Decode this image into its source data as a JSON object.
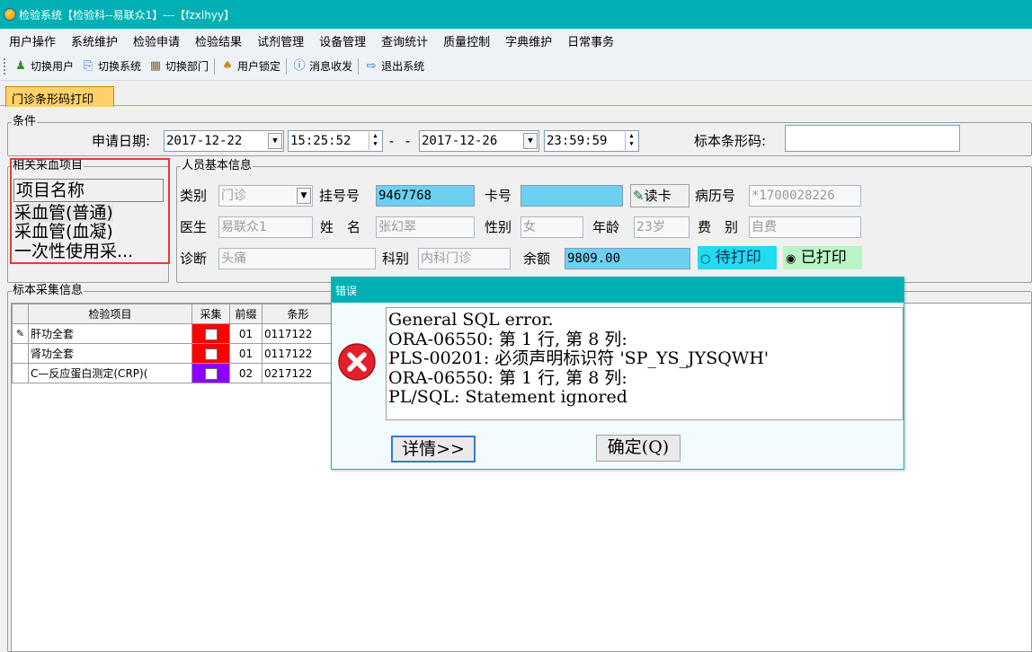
{
  "window": {
    "title": "检验系统【检验科--易联众1】---【fzxlhyy】"
  },
  "menu": [
    "用户操作",
    "系统维护",
    "检验申请",
    "检验结果",
    "试剂管理",
    "设备管理",
    "查询统计",
    "质量控制",
    "字典维护",
    "日常事务"
  ],
  "toolbar": {
    "switch_user": "切换用户",
    "switch_system": "切换系统",
    "switch_dept": "切换部门",
    "user_lock": "用户锁定",
    "messages": "消息收发",
    "exit": "退出系统"
  },
  "tab": {
    "label": "门诊条形码打印"
  },
  "conditions": {
    "group_label": "条件",
    "apply_date_label": "申请日期:",
    "date_from": "2017-12-22",
    "time_from": "15:25:52",
    "range_sep": "- -",
    "date_to": "2017-12-26",
    "time_to": "23:59:59",
    "barcode_label": "标本条形码:",
    "barcode_value": ""
  },
  "blood_items": {
    "group_label": "相关采血项目",
    "header": "项目名称",
    "items": [
      "采血管(普通)",
      "采血管(血凝)",
      "一次性使用采..."
    ]
  },
  "person": {
    "group_label": "人员基本信息",
    "category_label": "类别",
    "category_value": "门诊",
    "reg_no_label": "挂号号",
    "reg_no_value": "9467768",
    "card_label": "卡号",
    "card_value": "",
    "read_card_label": "读卡",
    "record_no_label": "病历号",
    "record_no_value": "*1700028226",
    "doctor_label": "医生",
    "doctor_value": "易联众1",
    "name_label": "姓　名",
    "name_value": "张幻翠",
    "sex_label": "性别",
    "sex_value": "女",
    "age_label": "年龄",
    "age_value": "23岁",
    "fee_label": "费　别",
    "fee_value": "自费",
    "diag_label": "诊断",
    "diag_value": "头痛",
    "dept_label": "科别",
    "dept_value": "内科门诊",
    "balance_label": "余额",
    "balance_value": "9809.00",
    "radio_pending": "待打印",
    "radio_printed": "已打印",
    "print_status": "已打印"
  },
  "samples": {
    "group_label": "标本采集信息",
    "columns": [
      "检验项目",
      "采集",
      "前缀",
      "条形"
    ],
    "rows": [
      {
        "item": "肝功全套",
        "color": "#ff0000",
        "prefix": "01",
        "barcode": "0117122"
      },
      {
        "item": "肾功全套",
        "color": "#ff0000",
        "prefix": "01",
        "barcode": "0117122"
      },
      {
        "item": "C—反应蛋白测定(CRP)(",
        "color": "#8b00ff",
        "prefix": "02",
        "barcode": "0217122"
      }
    ]
  },
  "error_dialog": {
    "title": "错误",
    "icon": "error-x-icon",
    "message_lines": [
      "General SQL error.",
      "ORA-06550: 第 1 行, 第 8 列:",
      "PLS-00201: 必须声明标识符 'SP_YS_JYSQWH'",
      "ORA-06550: 第 1 行, 第 8 列:",
      "PL/SQL: Statement ignored"
    ],
    "details_label": "详情>>",
    "ok_label": "确定(Q)"
  },
  "colors": {
    "titlebar": "#00b0b4",
    "tab_active": "#ffd16a",
    "highlight_field": "#6dd0f0",
    "highlight_box": "#e53935"
  }
}
